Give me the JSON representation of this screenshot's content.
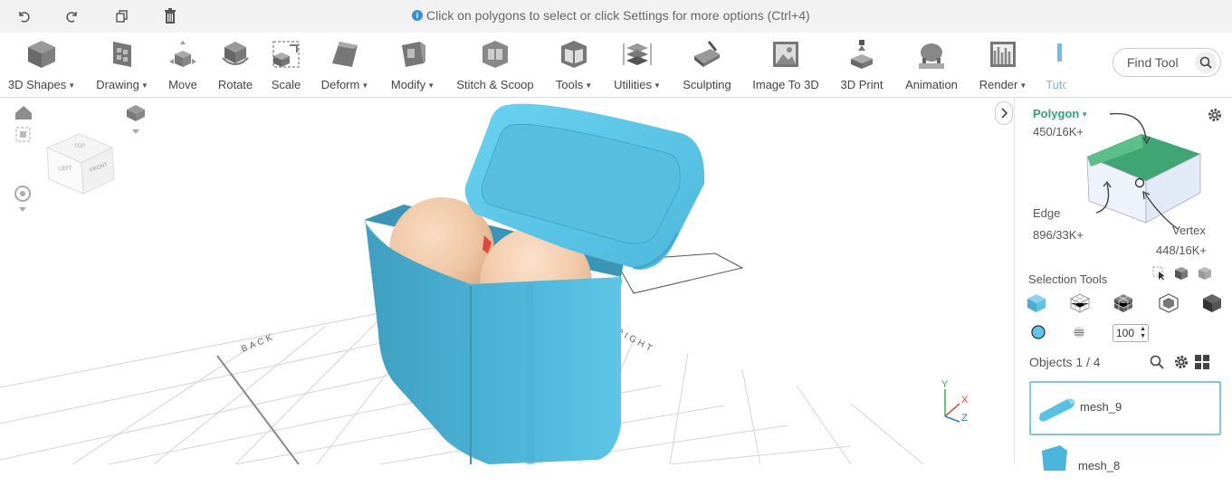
{
  "topbar": {
    "undo_icon": "undo-icon",
    "redo_icon": "redo-icon",
    "duplicate_icon": "duplicate-icon",
    "delete_icon": "trash-icon",
    "hint": "Click on polygons to select or click Settings for more options (Ctrl+4)"
  },
  "toolbar": {
    "items": [
      {
        "label": "3D Shapes",
        "dropdown": true
      },
      {
        "label": "Drawing",
        "dropdown": true
      },
      {
        "label": "Move",
        "dropdown": false
      },
      {
        "label": "Rotate",
        "dropdown": false
      },
      {
        "label": "Scale",
        "dropdown": false
      },
      {
        "label": "Deform",
        "dropdown": true
      },
      {
        "label": "Modify",
        "dropdown": true
      },
      {
        "label": "Stitch & Scoop",
        "dropdown": false
      },
      {
        "label": "Tools",
        "dropdown": true
      },
      {
        "label": "Utilities",
        "dropdown": true
      },
      {
        "label": "Sculpting",
        "dropdown": false
      },
      {
        "label": "Image To 3D",
        "dropdown": false
      },
      {
        "label": "3D Print",
        "dropdown": false
      },
      {
        "label": "Animation",
        "dropdown": false
      },
      {
        "label": "Render",
        "dropdown": true
      },
      {
        "label": "Tuto",
        "dropdown": false
      }
    ],
    "find_tool": "Find Tool"
  },
  "viewport": {
    "grid_labels": {
      "back": "BACK",
      "right": "RIGHT"
    },
    "cube_faces": {
      "left": "LEFT",
      "front": "FRONT",
      "top": "TOP"
    },
    "axes": {
      "x": "X",
      "y": "Y",
      "z": "Z"
    }
  },
  "panel": {
    "mode": "Polygon",
    "polygon_count": "450/16K+",
    "edge_label": "Edge",
    "edge_count": "896/33K+",
    "vertex_label": "Vertex",
    "vertex_count": "448/16K+",
    "selection_tools": "Selection Tools",
    "brush_size": "100",
    "objects_label": "Objects 1 / 4",
    "objects": [
      {
        "name": "mesh_9"
      },
      {
        "name": "mesh_8"
      }
    ]
  },
  "colors": {
    "accent_green": "#2aa876",
    "mesh_blue": "#4fbfe0",
    "skin": "#f0c9a8",
    "selected_border": "#7fc6e8"
  }
}
